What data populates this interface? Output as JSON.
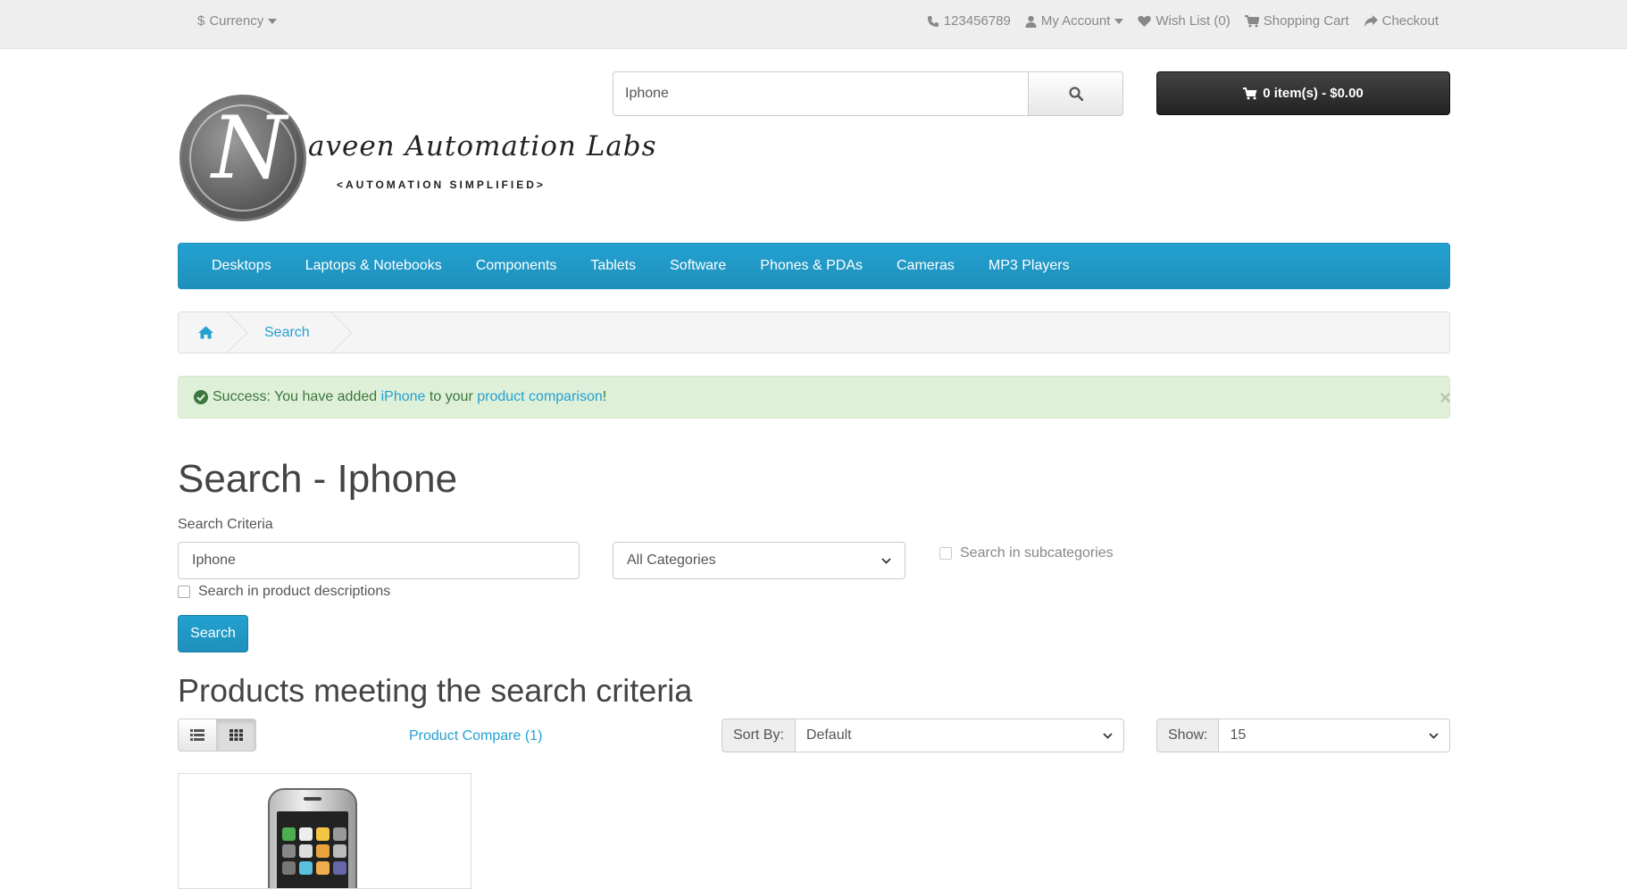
{
  "topbar": {
    "currency_label": "Currency",
    "currency_symbol": "$",
    "phone": "123456789",
    "my_account": "My Account",
    "wish_list": "Wish List (0)",
    "shopping_cart": "Shopping Cart",
    "checkout": "Checkout"
  },
  "header": {
    "logo_initial": "N",
    "logo_text": "aveen Automation Labs",
    "logo_tagline": "<AUTOMATION SIMPLIFIED>",
    "search_value": "Iphone",
    "cart_button": "0 item(s) - $0.00"
  },
  "menu": {
    "items": [
      "Desktops",
      "Laptops & Notebooks",
      "Components",
      "Tablets",
      "Software",
      "Phones & PDAs",
      "Cameras",
      "MP3 Players"
    ]
  },
  "breadcrumb": {
    "current": "Search"
  },
  "alert": {
    "prefix": "Success: You have added ",
    "product_link": "iPhone",
    "middle": " to your ",
    "comparison_link": "product comparison",
    "suffix": "!",
    "close": "×"
  },
  "search_page": {
    "title": "Search - Iphone",
    "criteria_label": "Search Criteria",
    "criteria_value": "Iphone",
    "category_selected": "All Categories",
    "subcategories_label": "Search in subcategories",
    "descriptions_label": "Search in product descriptions",
    "search_button": "Search",
    "results_heading": "Products meeting the search criteria",
    "product_compare": "Product Compare (1)",
    "sort_label": "Sort By:",
    "sort_value": "Default",
    "show_label": "Show:",
    "show_value": "15"
  },
  "colors": {
    "accent": "#23a1d1",
    "alert_bg": "#dff0d8",
    "alert_text": "#3c763d"
  }
}
